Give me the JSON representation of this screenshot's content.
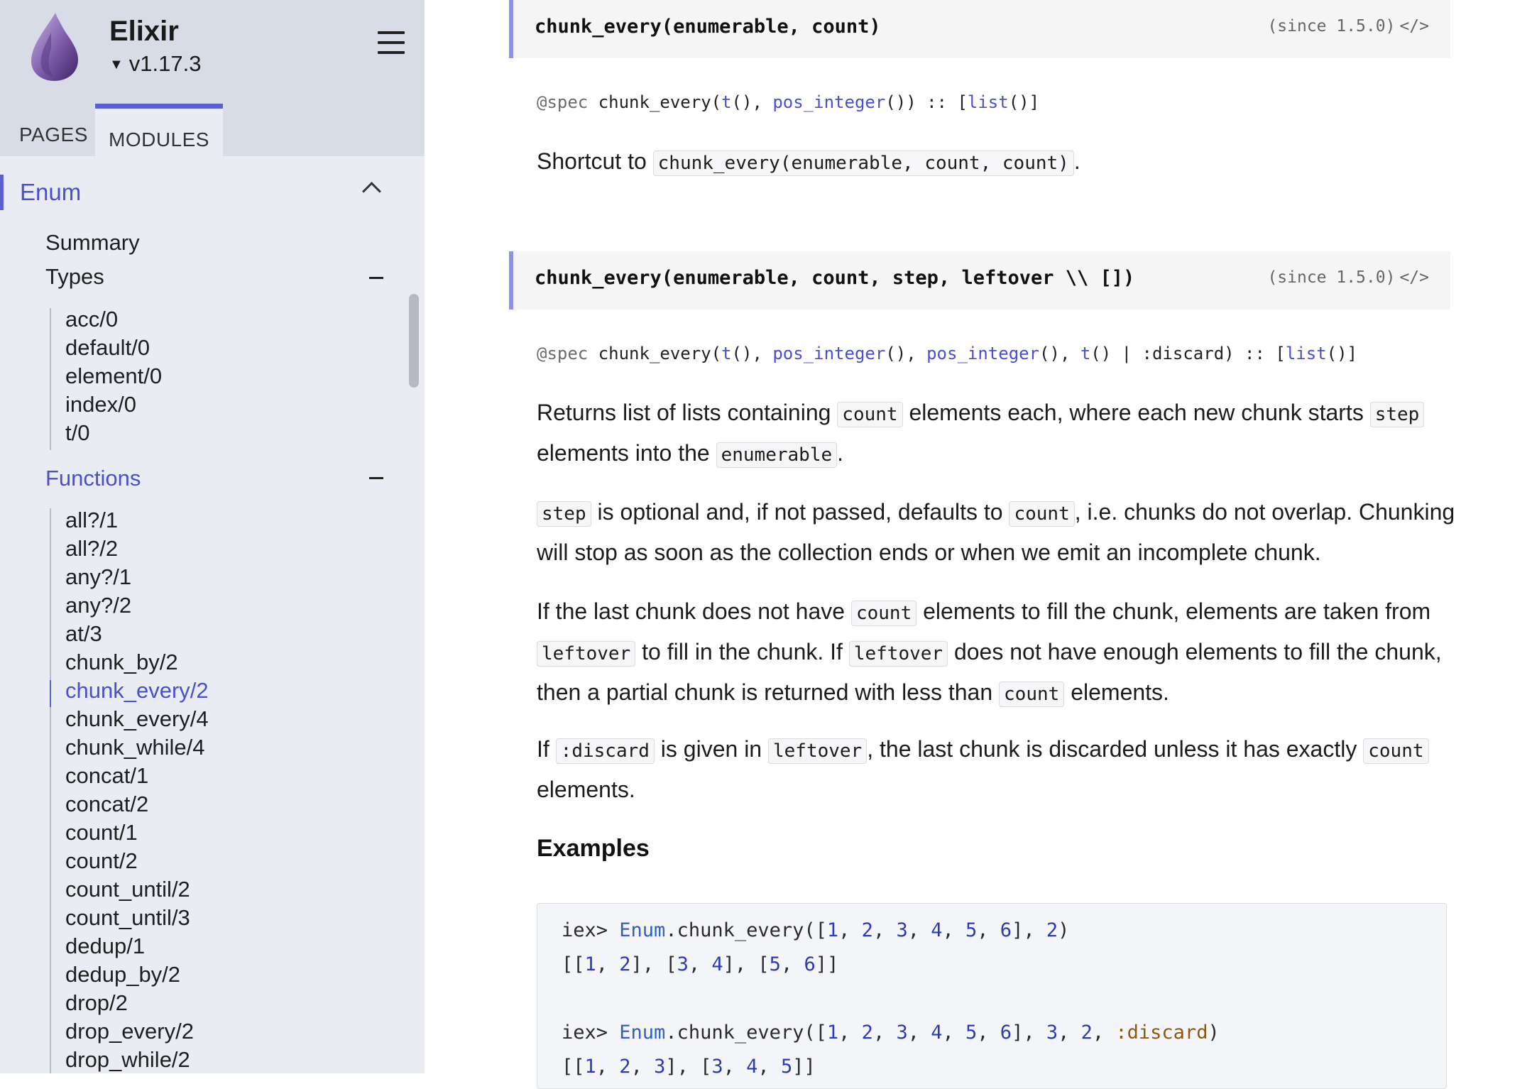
{
  "sidebar": {
    "project_name": "Elixir",
    "version": "v1.17.3",
    "tabs": {
      "pages": "PAGES",
      "modules": "MODULES"
    },
    "module": "Enum",
    "summary": "Summary",
    "types_label": "Types",
    "types": [
      "acc/0",
      "default/0",
      "element/0",
      "index/0",
      "t/0"
    ],
    "functions_label": "Functions",
    "functions": [
      "all?/1",
      "all?/2",
      "any?/1",
      "any?/2",
      "at/3",
      "chunk_by/2",
      "chunk_every/2",
      "chunk_every/4",
      "chunk_while/4",
      "concat/1",
      "concat/2",
      "count/1",
      "count/2",
      "count_until/2",
      "count_until/3",
      "dedup/1",
      "dedup_by/2",
      "drop/2",
      "drop_every/2",
      "drop_while/2"
    ],
    "active_function": "chunk_every/2"
  },
  "doc1": {
    "signature": "chunk_every(enumerable, count)",
    "since": "(since 1.5.0)",
    "spec": {
      "kw": "@spec",
      "p1": " chunk_every(",
      "t": "t",
      "p2": "(), ",
      "pos_integer": "pos_integer",
      "p3": "()) :: [",
      "list": "list",
      "p4": "()]"
    },
    "text_before": "Shortcut to ",
    "code": "chunk_every(enumerable, count, count)",
    "text_after": "."
  },
  "doc2": {
    "signature": "chunk_every(enumerable, count, step, leftover \\\\ [])",
    "since": "(since 1.5.0)",
    "spec": {
      "kw": "@spec",
      "p1": " chunk_every(",
      "t": "t",
      "p2": "(), ",
      "pos_integer": "pos_integer",
      "p3": "(), ",
      "p4": "(), ",
      "p5": "() | :discard) :: [",
      "list": "list",
      "p6": "()]"
    },
    "para1": {
      "a": "Returns list of lists containing ",
      "c1": "count",
      "b": " elements each, where each new chunk starts ",
      "c2": "step",
      "c": " elements into the ",
      "c3": "enumerable",
      "d": "."
    },
    "para2": {
      "c1": "step",
      "a": " is optional and, if not passed, defaults to ",
      "c2": "count",
      "b": ", i.e. chunks do not overlap. Chunking will stop as soon as the collection ends or when we emit an incomplete chunk."
    },
    "para3": {
      "a": "If the last chunk does not have ",
      "c1": "count",
      "b": " elements to fill the chunk, elements are taken from ",
      "c2": "leftover",
      "c": " to fill in the chunk. If ",
      "c3": "leftover",
      "d": " does not have enough elements to fill the chunk, then a partial chunk is returned with less than ",
      "c4": "count",
      "e": " elements."
    },
    "para4": {
      "a": "If ",
      "c1": ":discard",
      "b": " is given in ",
      "c2": "leftover",
      "c": ", the last chunk is discarded unless it has exactly ",
      "c3": "count",
      "d": " elements."
    },
    "examples_heading": "Examples"
  },
  "code_example": {
    "prompt": "iex> ",
    "module": "Enum",
    "call": ".chunk_every([",
    "result1": "[[1, 2], [3, 4], [5, 6]]",
    "result2_partial": "[[1, 2, 3], [3, 4, 5]]",
    "atom_discard": ":discard"
  },
  "colors": {
    "accent": "#5b5fcf",
    "link": "#4a4ed0",
    "sidebar_bg": "#e9ecf3",
    "header_bg": "#d8dce6"
  },
  "icons": {
    "logo": "elixir-drop-logo",
    "menu": "hamburger-icon",
    "collapse": "chevron-up-icon",
    "section_toggle": "minus-icon",
    "source": "code-icon"
  }
}
